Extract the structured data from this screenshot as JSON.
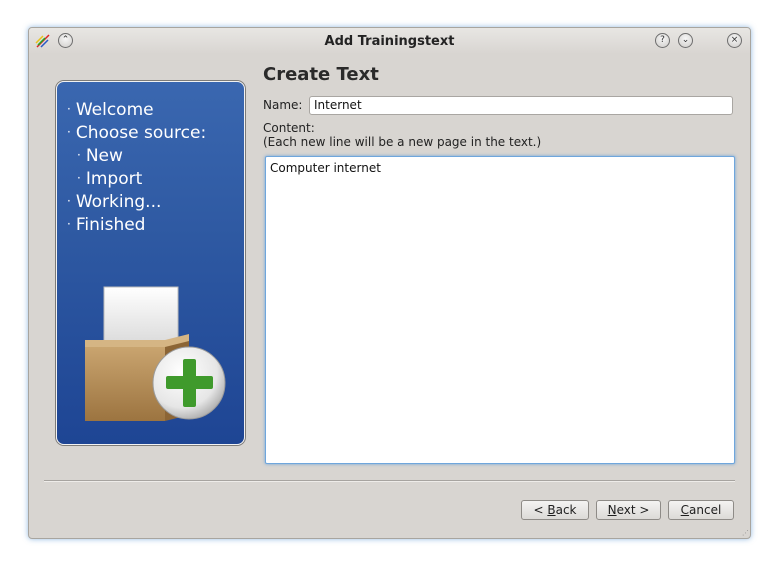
{
  "window": {
    "title": "Add Trainingstext",
    "help_glyph": "?",
    "minimize_glyph": "⌄",
    "shade_glyph": "⌃",
    "close_glyph": "×"
  },
  "sidebar": {
    "bullet": "·",
    "steps": [
      {
        "label": "Welcome",
        "sub": false
      },
      {
        "label": "Choose source:",
        "sub": false
      },
      {
        "label": "New",
        "sub": true
      },
      {
        "label": "Import",
        "sub": true
      },
      {
        "label": "Working...",
        "sub": false
      },
      {
        "label": "Finished",
        "sub": false
      }
    ]
  },
  "page": {
    "heading": "Create Text",
    "name_label": "Name:",
    "name_value": "Internet",
    "content_label": "Content:",
    "content_hint": "(Each new line will be a new page in the text.)",
    "content_value": "Computer internet"
  },
  "buttons": {
    "back_prefix": "< ",
    "back_mnemonic": "B",
    "back_rest": "ack",
    "next_mnemonic": "N",
    "next_rest": "ext >",
    "cancel_mnemonic": "C",
    "cancel_rest": "ancel"
  },
  "icons": [
    "app-icon",
    "help-icon",
    "minimize-icon",
    "shade-icon",
    "close-icon",
    "box-add-icon"
  ],
  "colors": {
    "sidebar_top": "#3a67b0",
    "sidebar_bottom": "#1e4594",
    "window_bg": "#d8d5d1",
    "focus": "#6fa6dc"
  }
}
